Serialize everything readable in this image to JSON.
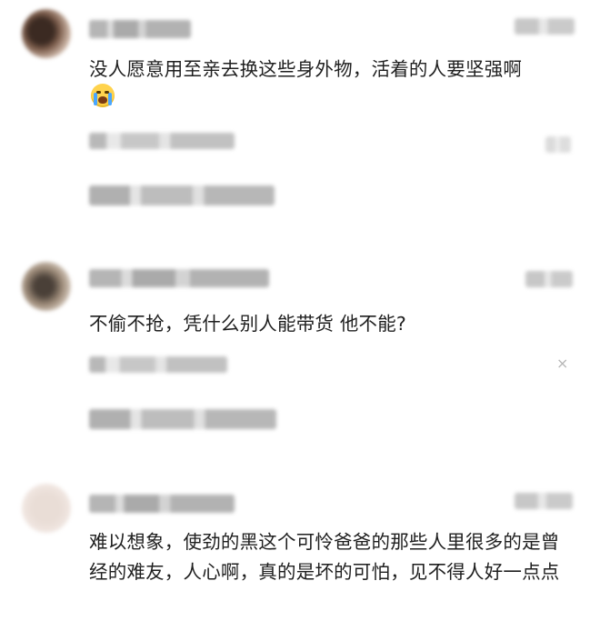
{
  "comments": [
    {
      "text": "没人愿意用至亲去换这些身外物，活着的人要坚强啊",
      "emoji": "crying-face-emoji",
      "replies_count": 2
    },
    {
      "text": "不偷不抢，凭什么别人能带货 他不能?",
      "close_glyph": "×",
      "replies_count": 2
    },
    {
      "text": "难以想象，使劲的黑这个可怜爸爸的那些人里很多的是曾经的难友，人心啊，真的是坏的可怕，见不得人好一点点"
    }
  ],
  "colors": {
    "text": "#1f1f1f",
    "background": "#ffffff",
    "emoji": "#ffd34d",
    "close_icon": "#b7b7b7"
  }
}
